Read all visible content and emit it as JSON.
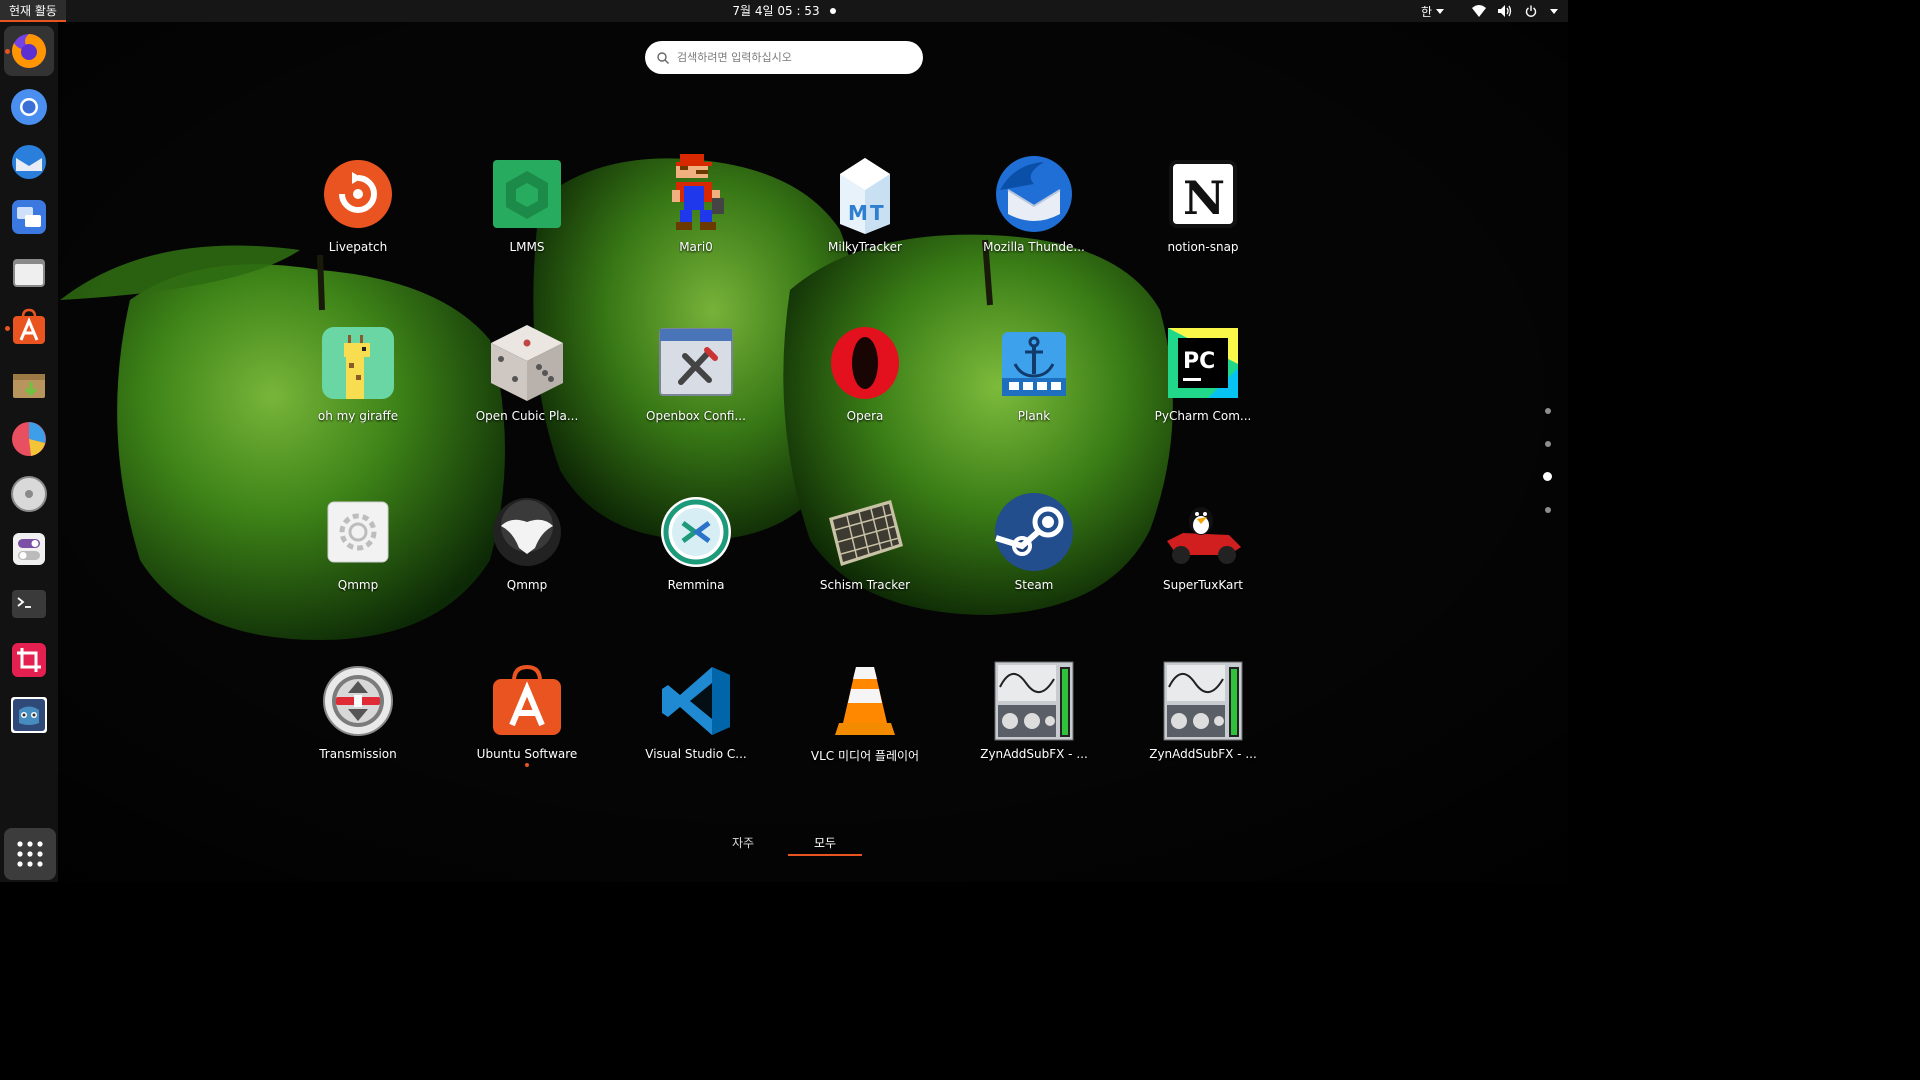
{
  "topbar": {
    "activities": "현재 활동",
    "clock": "7월 4일  05 : 53",
    "input_method": "한"
  },
  "search": {
    "placeholder": "검색하려면 입력하십시오"
  },
  "dock": {
    "items": [
      {
        "name": "firefox-icon",
        "running": true
      },
      {
        "name": "chromium-icon",
        "running": false
      },
      {
        "name": "thunderbird-icon",
        "running": false
      },
      {
        "name": "remote-desktop-icon",
        "running": false
      },
      {
        "name": "files-icon",
        "running": false
      },
      {
        "name": "ubuntu-software-icon",
        "running": true
      },
      {
        "name": "archive-manager-icon",
        "running": false
      },
      {
        "name": "disk-usage-icon",
        "running": false
      },
      {
        "name": "disks-icon",
        "running": false
      },
      {
        "name": "tweaks-icon",
        "running": false
      },
      {
        "name": "terminal-icon",
        "running": false
      },
      {
        "name": "screenshot-crop-icon",
        "running": false
      },
      {
        "name": "godot-icon",
        "running": false
      }
    ],
    "show_apps": "show-applications-icon"
  },
  "apps": [
    {
      "label": "Livepatch",
      "icon": "livepatch-icon"
    },
    {
      "label": "LMMS",
      "icon": "lmms-icon"
    },
    {
      "label": "Mari0",
      "icon": "mari0-icon"
    },
    {
      "label": "MilkyTracker",
      "icon": "milkytracker-icon"
    },
    {
      "label": "Mozilla Thunde...",
      "icon": "thunderbird-icon"
    },
    {
      "label": "notion-snap",
      "icon": "notion-icon"
    },
    {
      "label": "oh my giraffe",
      "icon": "giraffe-icon"
    },
    {
      "label": "Open Cubic Pla...",
      "icon": "dice-icon"
    },
    {
      "label": "Openbox Confi...",
      "icon": "openbox-config-icon"
    },
    {
      "label": "Opera",
      "icon": "opera-icon"
    },
    {
      "label": "Plank",
      "icon": "plank-anchor-icon"
    },
    {
      "label": "PyCharm Com...",
      "icon": "pycharm-icon"
    },
    {
      "label": "Qmmp",
      "icon": "qmmp-gear-icon"
    },
    {
      "label": "Qmmp",
      "icon": "qmmp-bird-icon"
    },
    {
      "label": "Remmina",
      "icon": "remmina-icon"
    },
    {
      "label": "Schism Tracker",
      "icon": "schism-tracker-icon"
    },
    {
      "label": "Steam",
      "icon": "steam-icon"
    },
    {
      "label": "SuperTuxKart",
      "icon": "supertuxkart-icon"
    },
    {
      "label": "Transmission",
      "icon": "transmission-icon"
    },
    {
      "label": "Ubuntu Software",
      "icon": "ubuntu-software-icon",
      "running": true
    },
    {
      "label": "Visual Studio C...",
      "icon": "vscode-icon"
    },
    {
      "label": "VLC 미디어 플레이어",
      "icon": "vlc-icon"
    },
    {
      "label": "ZynAddSubFX - ...",
      "icon": "zynaddsubfx-icon"
    },
    {
      "label": "ZynAddSubFX - ...",
      "icon": "zynaddsubfx-icon"
    }
  ],
  "pagination": {
    "pages": 4,
    "current": 3
  },
  "tabs": {
    "frequent": "자주",
    "all": "모두"
  },
  "colors": {
    "accent": "#e95420",
    "topbar": "#161616",
    "dock": "#141414"
  }
}
